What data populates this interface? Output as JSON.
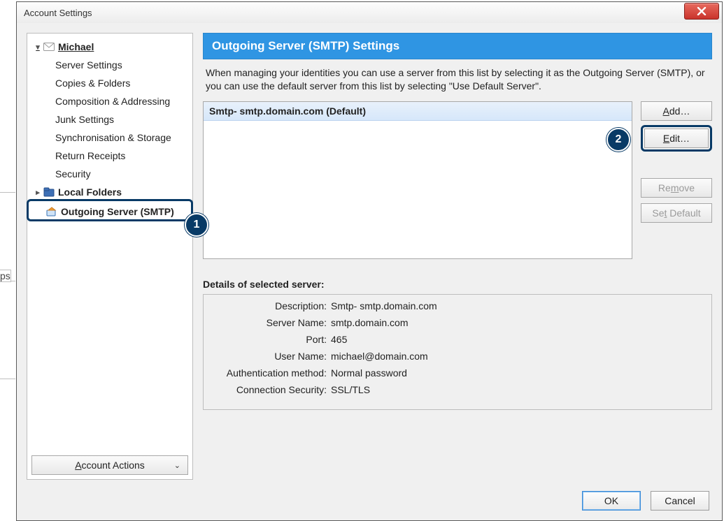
{
  "bg": {
    "ps_fragment": "ps"
  },
  "window": {
    "title": "Account Settings",
    "close_tooltip": "Close"
  },
  "tree": {
    "account_name": "Michael",
    "items": [
      "Server Settings",
      "Copies & Folders",
      "Composition & Addressing",
      "Junk Settings",
      "Synchronisation & Storage",
      "Return Receipts",
      "Security"
    ],
    "local_folders": "Local Folders",
    "smtp": "Outgoing Server (SMTP)"
  },
  "account_actions": {
    "prefix": "A",
    "rest": "ccount Actions"
  },
  "callouts": {
    "one": "1",
    "two": "2"
  },
  "content": {
    "heading": "Outgoing Server (SMTP) Settings",
    "description": "When managing your identities you can use a server from this list by selecting it as the Outgoing Server (SMTP), or you can use the default server from this list by selecting \"Use Default Server\".",
    "server_item": "Smtp- smtp.domain.com (Default)",
    "buttons": {
      "add_prefix": "A",
      "add_rest": "dd…",
      "edit_prefix": "E",
      "edit_rest": "dit…",
      "remove_pre": "Re",
      "remove_u": "m",
      "remove_post": "ove",
      "setdef_pre": "Se",
      "setdef_u": "t",
      "setdef_post": " Default"
    },
    "details_title": "Details of selected server:",
    "details": {
      "description_lbl": "Description:",
      "description_val": "Smtp- smtp.domain.com",
      "server_lbl": "Server Name:",
      "server_val": "smtp.domain.com",
      "port_lbl": "Port:",
      "port_val": "465",
      "user_lbl": "User Name:",
      "user_val": "michael@domain.com",
      "auth_lbl": "Authentication method:",
      "auth_val": "Normal password",
      "sec_lbl": "Connection Security:",
      "sec_val": "SSL/TLS"
    }
  },
  "footer": {
    "ok": "OK",
    "cancel": "Cancel"
  }
}
